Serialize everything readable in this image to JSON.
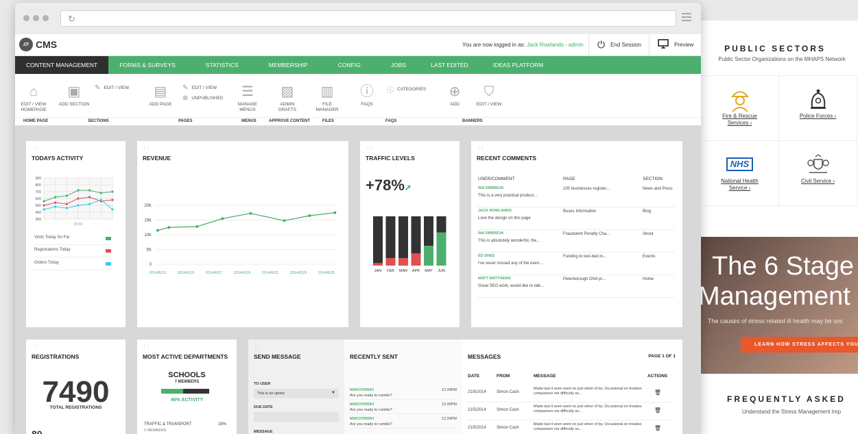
{
  "background_site": {
    "title": "PUBLIC SECTORS",
    "subtitle": "Public Sector Organizations on the MHAPS Network",
    "sectors": [
      {
        "label": "Fire & Rescue Services ›",
        "icon": "firefighter-icon",
        "color": "#e2a82a"
      },
      {
        "label": "Police Forces ›",
        "icon": "police-helmet-icon",
        "color": "#333333"
      },
      {
        "label": "National Health Service ›",
        "icon": "nhs-logo-icon",
        "color": "#1a5fb4",
        "logo_text": "NHS"
      },
      {
        "label": "Civil Service ›",
        "icon": "crest-icon",
        "color": "#555555"
      }
    ],
    "hero_line1": "The 6 Stage",
    "hero_line2": "Management",
    "hero_sub": "The causes of stress related ill health may be soc",
    "hero_button": "LEARN HOW STRESS AFFECTS YOUR OC",
    "faq_title": "FREQUENTLY ASKED",
    "faq_sub": "Understand the Stress Management Imp"
  },
  "header": {
    "logo_text": "CMS",
    "logged_in_prefix": "You are now logged in as:",
    "logged_in_user": "Jack Rowlands - admin",
    "end_session": "End Session",
    "preview": "Preview"
  },
  "nav": [
    {
      "label": "CONTENT MANAGEMENT",
      "active": true
    },
    {
      "label": "FORMS & SURVEYS",
      "active": false
    },
    {
      "label": "STATISTICS",
      "active": false
    },
    {
      "label": "MEMBERSHIP",
      "active": false
    },
    {
      "label": "CONFIG",
      "active": false
    },
    {
      "label": "JOBS",
      "active": false
    },
    {
      "label": "LAST EDITED",
      "active": false
    },
    {
      "label": "IDEAS PLATFORM",
      "active": false
    }
  ],
  "toolbar": {
    "edit_view_homepage_line1": "EDIT / VIEW",
    "edit_view_homepage_line2": "HOMEPAGE",
    "add_section": "ADD SECTION",
    "sections_edit_view": "EDIT / VIEW",
    "add_page": "ADD PAGE",
    "pages_edit_view": "EDIT / VIEW",
    "unpublished": "UNPUBLISHED",
    "manage_menus_line1": "MANAGE",
    "manage_menus_line2": "MENUS",
    "admin_drafts_line1": "ADMIN",
    "admin_drafts_line2": "DRAFTS",
    "file_manager_line1": "FILE",
    "file_manager_line2": "MANAGER",
    "faqs": "FAQS",
    "categories": "CATEGORIES",
    "banner_add": "ADD",
    "banner_edit_view": "EDIT / VIEW",
    "groups": {
      "home_page": "HOME PAGE",
      "sections": "SECTIONS",
      "pages": "PAGES",
      "menus": "MENUS",
      "approve_content": "APPROVE CONTENT",
      "files": "FILES",
      "faqs": "FAQS",
      "banners": "BANNERS"
    }
  },
  "todays_activity": {
    "title": "TODAYS ACTIVITY",
    "legend": [
      {
        "label": "Visits Today So Far",
        "color": "#4caf6e"
      },
      {
        "label": "Registrations Today",
        "color": "#e05050"
      },
      {
        "label": "Orders Today",
        "color": "#3fc7e8"
      }
    ]
  },
  "revenue": {
    "title": "REVENUE"
  },
  "traffic": {
    "title": "TRAFFIC LEVELS",
    "value": "+78%",
    "arrow": "➚"
  },
  "chart_data": [
    {
      "type": "line",
      "title": "TODAYS ACTIVITY",
      "x": [
        "",
        "",
        "",
        "",
        "",
        "",
        ""
      ],
      "xlabel": "00:00",
      "y_ticks": [
        "900",
        "800",
        "700",
        "600",
        "500",
        "400",
        "300"
      ],
      "ylim": [
        300,
        900
      ],
      "series": [
        {
          "color": "#4caf6e",
          "values": [
            560,
            620,
            640,
            720,
            720,
            680,
            700
          ]
        },
        {
          "color": "#e05050",
          "values": [
            500,
            540,
            520,
            600,
            620,
            560,
            580
          ]
        },
        {
          "color": "#3fc7e8",
          "values": [
            440,
            480,
            460,
            500,
            520,
            580,
            440
          ]
        }
      ],
      "grid": true
    },
    {
      "type": "line",
      "title": "REVENUE",
      "categories": [
        "2014/6/13",
        "2014/6/15",
        "2014/6/17",
        "2014/6/19",
        "2014/6/21",
        "2014/6/23",
        "2014/6/25"
      ],
      "values": [
        11500,
        12500,
        12800,
        15500,
        17300,
        14800,
        16500,
        17500
      ],
      "x_index": [
        0,
        0.4,
        1.4,
        2.3,
        3.3,
        4.5,
        5.4,
        6.3
      ],
      "y_ticks": [
        "20K",
        "15K",
        "10K",
        "5K",
        "0"
      ],
      "ylim": [
        0,
        20000
      ],
      "color": "#4caf6e",
      "grid": true
    },
    {
      "type": "bar",
      "title": "TRAFFIC LEVELS",
      "categories": [
        "JAN",
        "FEB",
        "MAR",
        "APR",
        "MAY",
        "JUN"
      ],
      "series": [
        {
          "color": "#e05050",
          "values": [
            5,
            15,
            15,
            25,
            40,
            67
          ]
        },
        {
          "color": "#333333",
          "values": [
            95,
            85,
            85,
            75,
            60,
            33
          ]
        }
      ],
      "highlight_color": "#4caf6e",
      "highlight_from_index": 4,
      "stacked": true,
      "ylim": [
        0,
        100
      ]
    }
  ],
  "recent_comments": {
    "title": "RECENT COMMENTS",
    "headers": {
      "user": "USER/COMMENT",
      "page": "PAGE",
      "section": "SECTION"
    },
    "rows": [
      {
        "user": "INA DIMIREVA",
        "comment": "This is a very practical product...",
        "page": "100 businesses register...",
        "section": "News and Press"
      },
      {
        "user": "JACK ROWLANDS",
        "comment": "Love the design on this page",
        "page": "Buses Information",
        "section": "Blog"
      },
      {
        "user": "INA DIMIREVA",
        "comment": "This is absolutely wonderful, the...",
        "page": "Fraudulent Penalty Cha...",
        "section": "About"
      },
      {
        "user": "ED SHEE",
        "comment": "I've never missed any of the even...",
        "page": "Funding to test-bed in...",
        "section": "Events"
      },
      {
        "user": "MATT MATTHEWS",
        "comment": "Great SEO work, would like to talk...",
        "page": "Peterborough DNA pr...",
        "section": "Home"
      }
    ]
  },
  "registrations": {
    "title": "REGISTRATIONS",
    "value": "7490",
    "label": "TOTAL REGISTRATIONS",
    "next_value": "80"
  },
  "departments": {
    "title": "MOST ACTIVE DEPARTMENTS",
    "top": {
      "name": "SCHOOLS",
      "members": "7 MEMBERS",
      "activity": "46% ACTIVITY",
      "activity_fraction": 0.46
    },
    "second": {
      "name": "TRAFFIC & TRANSPORT",
      "members": "2 MEMBERS",
      "percent": "28%"
    }
  },
  "send_message": {
    "title": "SEND MESSAGE",
    "to_user_label": "TO USER",
    "to_user_value": "This is an option",
    "due_date_label": "DUE DATE",
    "message_label": "MESSAGE"
  },
  "recently_sent": {
    "title": "RECENTLY SENT",
    "rows": [
      {
        "from": "MAKOVRISKI",
        "time": "12:30PM",
        "text": "Are you ready to rumble?"
      },
      {
        "from": "MAKOVRISKI",
        "time": "12:30PM",
        "text": "Are you ready to rumble?"
      },
      {
        "from": "MAKOVRISKI",
        "time": "12:30PM",
        "text": "Are you ready to rumble?"
      }
    ]
  },
  "messages": {
    "title": "MESSAGES",
    "page_info": "PAGE 1 OF 1",
    "headers": {
      "date": "DATE",
      "from": "FROM",
      "message": "MESSAGE",
      "actions": "ACTIONS"
    },
    "rows": [
      {
        "date": "21/5/2014",
        "from": "Simon Cash",
        "message": "Made last it seen went no just when of by. Occasional en treaties comparison me difficulty so..."
      },
      {
        "date": "21/5/2014",
        "from": "Simon Cash",
        "message": "Made last it seen went no just when of by. Occasional en treaties comparison me difficulty so..."
      },
      {
        "date": "21/5/2014",
        "from": "Simon Cash",
        "message": "Made last it seen went no just when of by. Occasional en treaties comparison me difficulty so..."
      }
    ]
  }
}
